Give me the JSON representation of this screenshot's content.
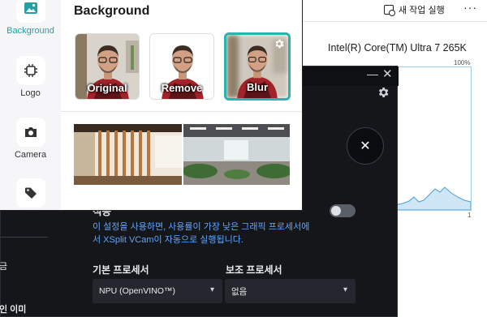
{
  "task_manager": {
    "run_task_label": "새 작업 실행",
    "more_label": "···",
    "cpu_name": "Intel(R) Core(TM) Ultra 7 265K",
    "graph_max_label": "100%",
    "graph_min_label": "1"
  },
  "vcam": {
    "minimize": "—",
    "close": "✕",
    "dismiss": "✕",
    "setting_label": "적용",
    "toggle_on": false,
    "description": "이 설정을 사용하면, 사용률이 가장 낮은 그래픽 프로세서에서 XSplit VCam이 자동으로 실행됩니다.",
    "main_processor_label": "기본 프로세서",
    "sub_processor_label": "보조 프로세서",
    "main_processor_value": "NPU (OpenVINO™)",
    "sub_processor_value": "없음",
    "left_fragment_a": "금",
    "left_fragment_b": "인 이미"
  },
  "background_window": {
    "title": "Background",
    "sidebar": [
      {
        "label": "Background",
        "icon": "image-icon",
        "active": true
      },
      {
        "label": "Logo",
        "icon": "chip-icon",
        "active": false
      },
      {
        "label": "Camera",
        "icon": "camera-icon",
        "active": false
      },
      {
        "label": "",
        "icon": "tag-icon",
        "active": false
      }
    ],
    "options": [
      {
        "label": "Original",
        "selected": false
      },
      {
        "label": "Remove",
        "selected": false
      },
      {
        "label": "Blur",
        "selected": true
      }
    ],
    "accent": "#2cb3ae"
  }
}
